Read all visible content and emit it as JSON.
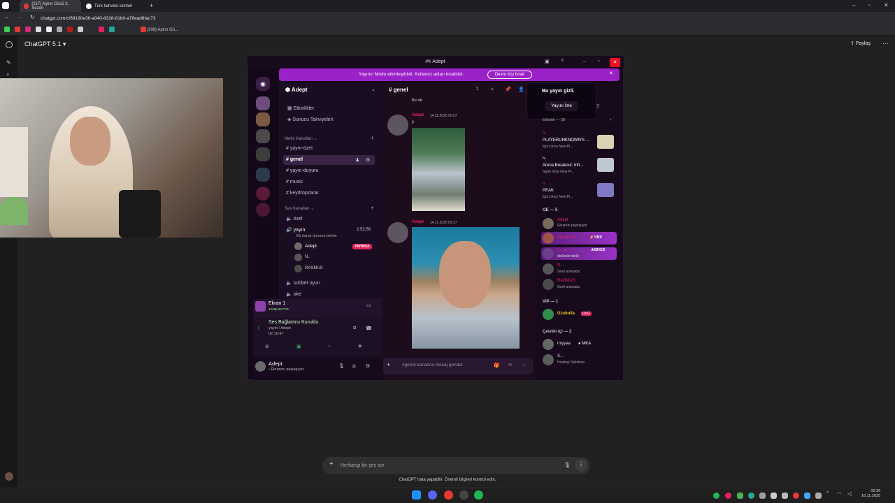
{
  "browser": {
    "tabs": [
      {
        "label": "(227) Aşkın Gücü 3. Sezon",
        "color": "#e53935"
      },
      {
        "label": "Türk kahvesi isimleri",
        "color": "#ffffff"
      }
    ],
    "url": "chatgpt.com/c/69190e36-a040-8328-81b0-a76ead8fac73",
    "bookmark_label": "(208) Aşkın Gü..."
  },
  "chatgpt": {
    "model_title": "ChatGPT 5.1",
    "share_label": "Paylaş",
    "composer_placeholder": "Herhangi bir şey sor",
    "disclaimer": "ChatGPT hata yapabilir. Önemli bilgileri kontrol edin."
  },
  "discord": {
    "window_title": "Adept",
    "banner_text": "Yayıncı Modu etkinleştirildi. Kullanıcı adları kısaltıldı.",
    "banner_button": "Devre dışı bırak",
    "server_name": "Adept",
    "top_items": [
      "Etkinlikler",
      "Sunucu Takviyeleri"
    ],
    "text_category": "Metin Kanalları",
    "text_channels": [
      "yayın-özel",
      "genel",
      "yayın-duyuru",
      "music",
      "keydropzarar"
    ],
    "voice_category": "Ses Kanalları",
    "voice_channels": [
      "özel",
      "yayın",
      "sohbet oyun",
      "oke"
    ],
    "voice_timer": "2:52:59",
    "voice_status": "Bir kanal durumu belirle",
    "voice_users": [
      "Adept",
      "N..",
      "RASMUS"
    ],
    "live_badge": "YAYINDA",
    "screen_title": "Ekran 1",
    "screen_sub": "1440p 60 FPS",
    "connection_title": "Ses Bağlantısı Kuruldu",
    "connection_sub": "yayın / Adept",
    "connection_time": "02:16:47",
    "user_name": "Adept",
    "user_status": "Ekranını paylaşıyor",
    "chat_channel": "genel",
    "chat_messages": [
      {
        "text": "bu ne"
      },
      {
        "author": "Adept",
        "time": "14.11.2025 00:57",
        "text": "ş"
      },
      {
        "author": "Adept",
        "time": "14.11.2025 02:27",
        "text": ""
      }
    ],
    "input_placeholder": "#genel kanalına mesaj gönder",
    "tooltip_title": "Bu yayın gizli.",
    "tooltip_button": "Yayını İzle",
    "tooltip_count": "3",
    "members_section_top": "Etkinlik — 28",
    "activities": [
      {
        "name": "N..",
        "game": "PLAYERUNKNOWN'S ...",
        "sub": "İgün önce  New Pl..."
      },
      {
        "name": "N..",
        "game": "Arena Breakout: Infi...",
        "sub": "Sgün önce  New Pl..."
      },
      {
        "name": "m......",
        "game": "PEAK",
        "sub": "İgün önce  New Pl..."
      }
    ],
    "group_oe": "OE — 5",
    "oe_members": [
      {
        "name": "Adept",
        "sub": "Ekranını paylaşıyor"
      },
      {
        "name": "Ayman M..",
        "tag": "VNX",
        "sub": ""
      },
      {
        "name": "r.....y",
        "tag": "BNCE",
        "sub": "idolünün idolü"
      },
      {
        "name": "N..",
        "sub": "Sesli aramada"
      },
      {
        "name": "RASMUS",
        "sub": "Sesli aramada"
      }
    ],
    "group_vip": "VIP — 1",
    "vip_members": [
      {
        "name": "Uzuhulla",
        "tag": "UVG"
      }
    ],
    "group_online": "Çevrim içi — 2",
    "online_members": [
      {
        "name": "miyyaa",
        "tag": "MKA",
        "sub": ""
      },
      {
        "name": "S...",
        "sub": "Hosting Talkshow"
      }
    ]
  },
  "taskbar": {
    "time": "02:36",
    "date": "16.11.2025"
  }
}
